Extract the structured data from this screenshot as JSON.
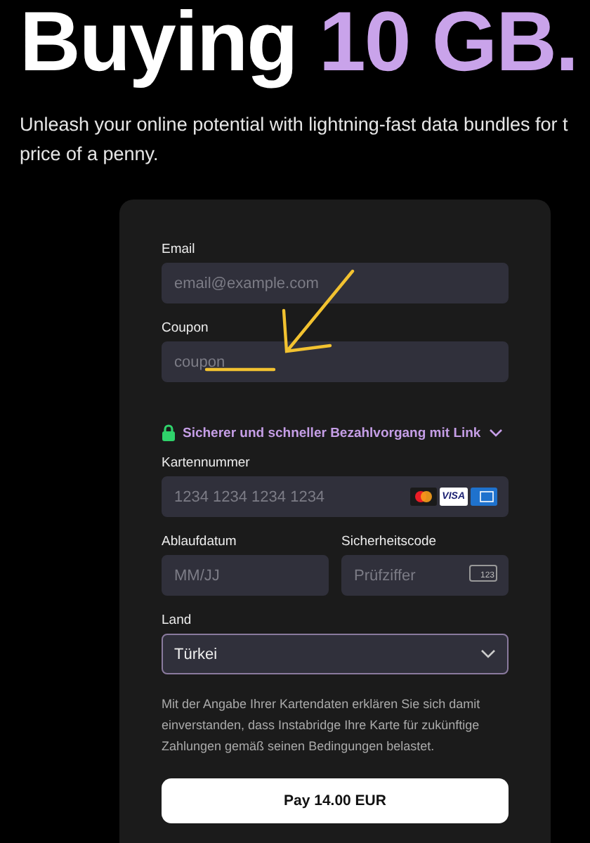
{
  "heading": {
    "prefix": "Buying",
    "highlight": "10 GB."
  },
  "subtitle": "Unleash your online potential with lightning-fast data bundles for t price of a penny.",
  "form": {
    "email": {
      "label": "Email",
      "placeholder": "email@example.com"
    },
    "coupon": {
      "label": "Coupon",
      "placeholder": "coupon"
    },
    "link_banner": {
      "text": "Sicherer und schneller Bezahlvorgang mit Link",
      "expanded": false
    },
    "card_number": {
      "label": "Kartennummer",
      "placeholder": "1234 1234 1234 1234",
      "brands": [
        "VISA"
      ]
    },
    "expiry": {
      "label": "Ablaufdatum",
      "placeholder": "MM/JJ"
    },
    "cvc": {
      "label": "Sicherheitscode",
      "placeholder": "Prüfziffer",
      "icon_text": "123"
    },
    "country": {
      "label": "Land",
      "value": "Türkei"
    },
    "notice": "Mit der Angabe Ihrer Kartendaten erklären Sie sich damit einverstanden, dass Instabridge Ihre Karte für zukünftige Zahlungen gemäß seinen Bedingungen belastet.",
    "pay_button": "Pay 14.00 EUR"
  }
}
